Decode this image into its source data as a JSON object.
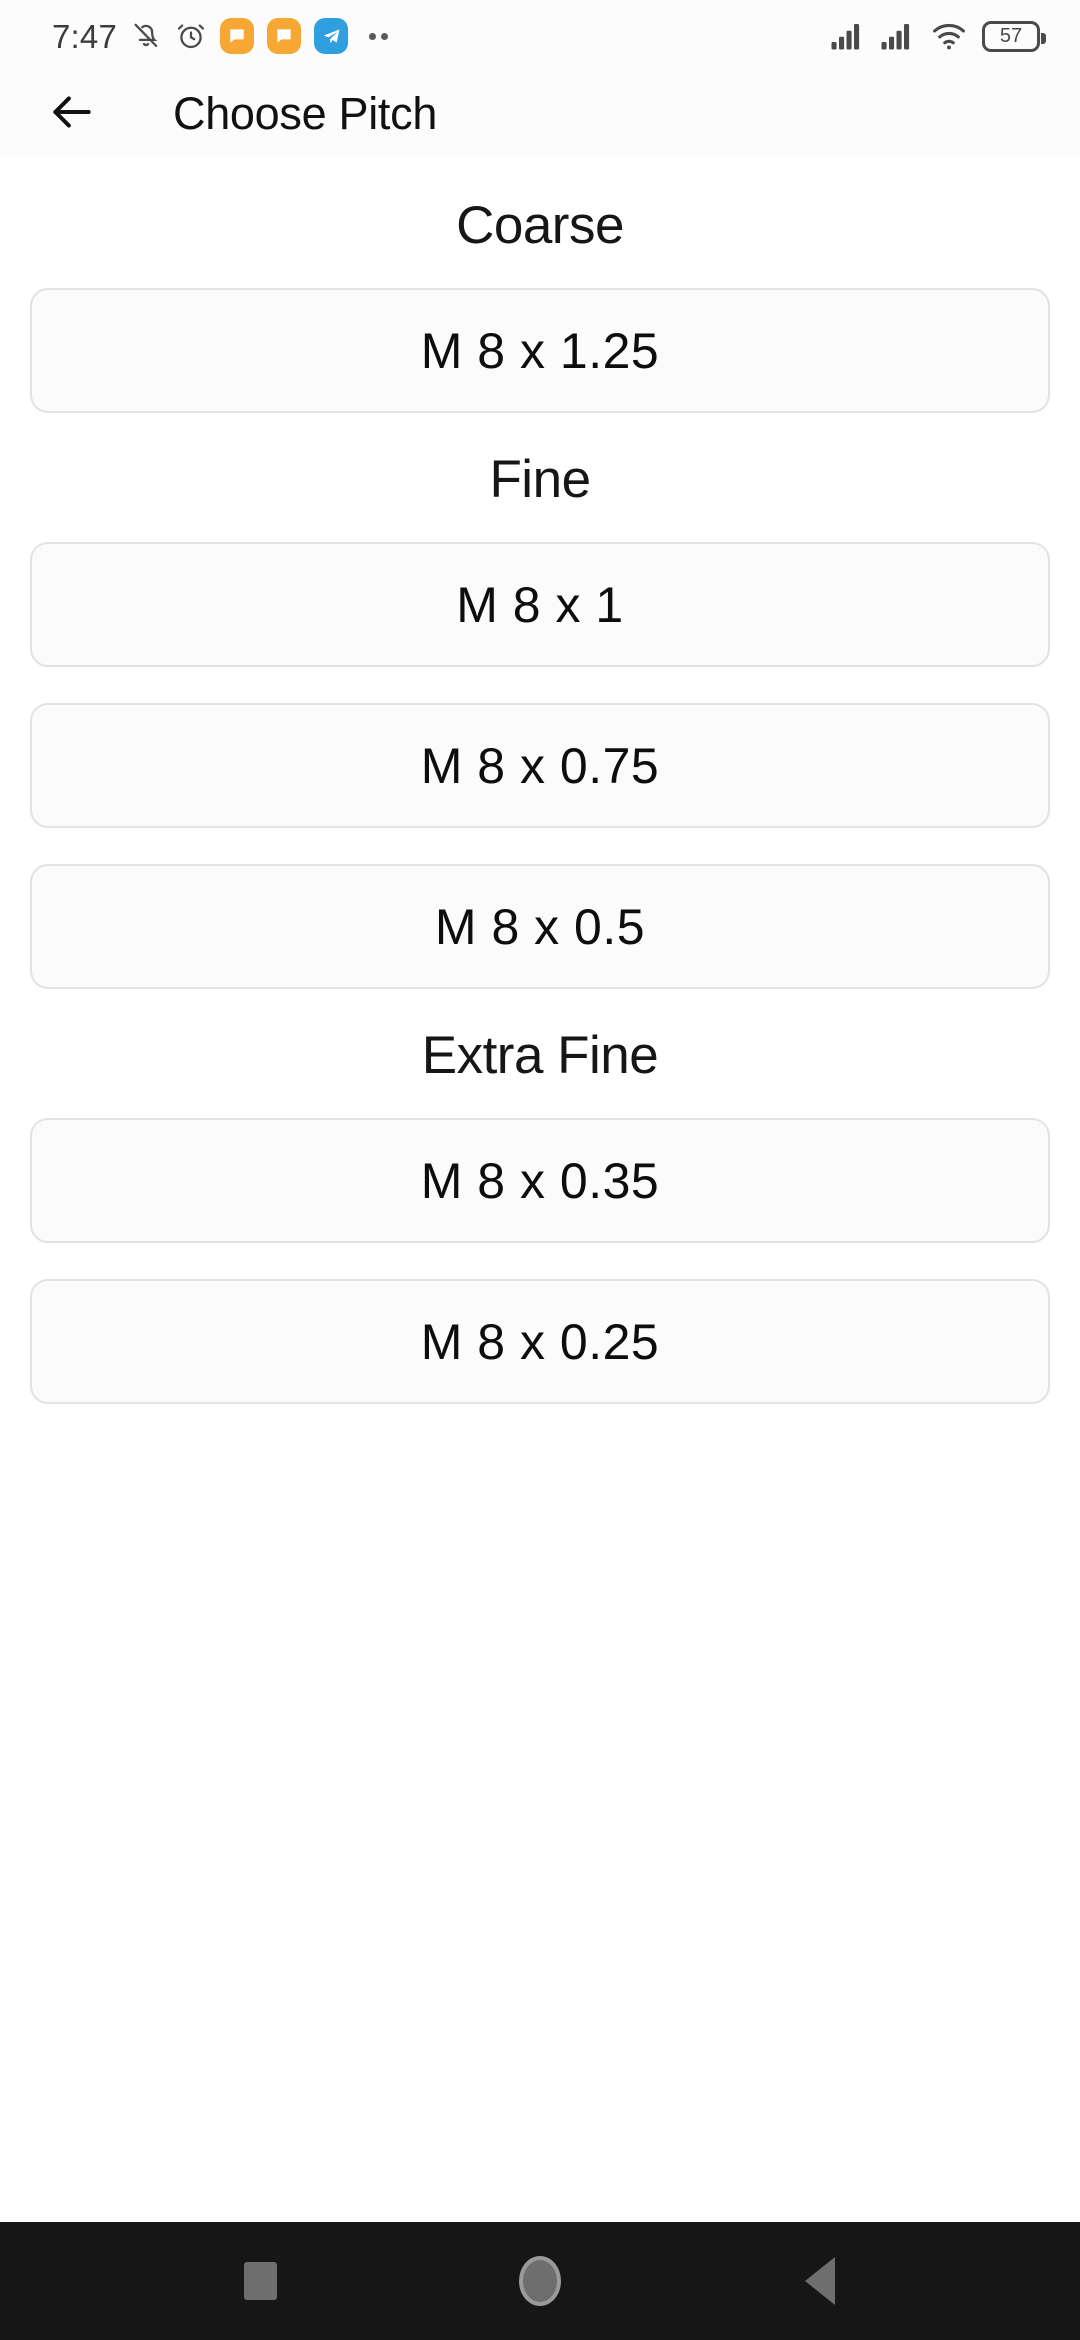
{
  "status_bar": {
    "time": "7:47",
    "battery_level": "57",
    "icons": {
      "bell_muted": "bell-muted-icon",
      "alarm": "alarm-clock-icon",
      "app_badge_1": "orange-message-app-icon",
      "app_badge_2": "orange-message-app-icon",
      "app_badge_3": "blue-telegram-app-icon",
      "overflow": "more-notifications-icon",
      "signal_1": "cellular-signal-icon",
      "signal_2": "cellular-signal-icon",
      "wifi": "wifi-icon",
      "battery": "battery-icon"
    },
    "colors": {
      "app_badge_orange": "#F6A734",
      "app_badge_blue": "#2F9FE0",
      "icon_gray": "#4A4A4A",
      "bar_background": "#FCFCFC"
    }
  },
  "app_bar": {
    "back_label": "back-arrow",
    "title": "Choose Pitch",
    "background": "#FCFCFC"
  },
  "main": {
    "sections": [
      {
        "heading": "Coarse",
        "options": [
          {
            "label": "M 8 x 1.25"
          }
        ]
      },
      {
        "heading": "Fine",
        "options": [
          {
            "label": "M 8 x 1"
          },
          {
            "label": "M 8 x 0.75"
          },
          {
            "label": "M 8 x 0.5"
          }
        ]
      },
      {
        "heading": "Extra Fine",
        "options": [
          {
            "label": "M 8 x 0.35"
          },
          {
            "label": "M 8 x 0.25"
          }
        ]
      }
    ],
    "card_style": {
      "background": "#FBFBFB",
      "border_color": "#E2E2E2"
    }
  },
  "nav_bar": {
    "background": "#161616",
    "buttons": [
      {
        "name": "recents",
        "glyph": "square"
      },
      {
        "name": "home",
        "glyph": "circle"
      },
      {
        "name": "back",
        "glyph": "triangle-left"
      }
    ]
  }
}
